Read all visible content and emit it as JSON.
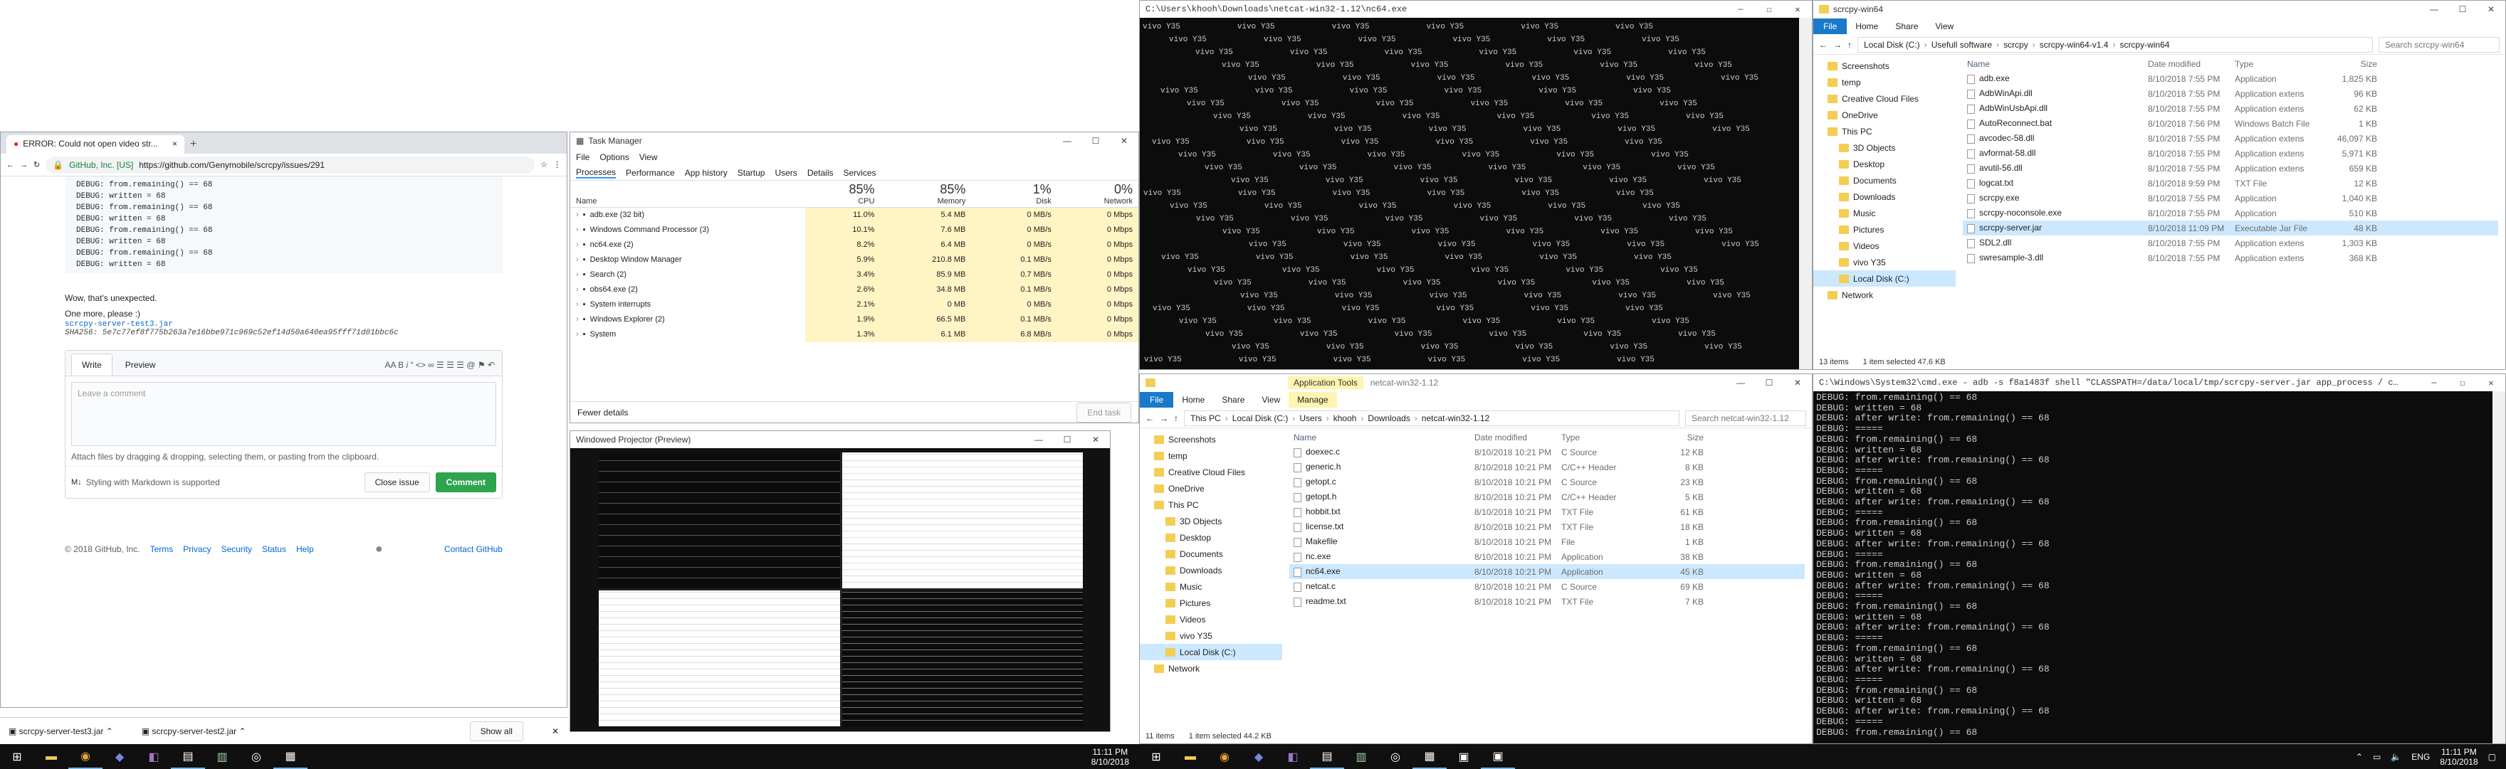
{
  "chrome": {
    "tab_title": "ERROR: Could not open video str...",
    "tab_close": "×",
    "new_tab": "+",
    "security": "GitHub, Inc. [US]",
    "url": "https://github.com/Genymobile/scrcpy/issues/291",
    "code_lines": [
      "DEBUG: from.remaining() == 68",
      "DEBUG: written = 68",
      "DEBUG: from.remaining() == 68",
      "DEBUG: written = 68",
      "DEBUG: from.remaining() == 68",
      "DEBUG: written = 68",
      "DEBUG: from.remaining() == 68",
      "DEBUG: written = 68"
    ],
    "p1": "Wow, that's unexpected.",
    "p2": "One more, please :)",
    "file_link": "scrcpy-server-test3.jar",
    "sha": "SHA256: 5e7c77ef8f775b263a7e16bbe971c969c52ef14d50a640ea95fff71d01bbc6c",
    "tab_write": "Write",
    "tab_preview": "Preview",
    "placeholder": "Leave a comment",
    "attach_text": "Attach files by dragging & dropping, selecting them, or pasting from the clipboard.",
    "markdown_note": "Styling with Markdown is supported",
    "close_issue": "Close issue",
    "comment": "Comment",
    "footer_copy": "© 2018 GitHub, Inc.",
    "footer_links": [
      "Terms",
      "Privacy",
      "Security",
      "Status",
      "Help"
    ],
    "contact": "Contact GitHub",
    "downloads": [
      "scrcpy-server-test3.jar",
      "scrcpy-server-test2.jar"
    ],
    "show_all": "Show all"
  },
  "taskmgr": {
    "title": "Task Manager",
    "menu": [
      "File",
      "Options",
      "View"
    ],
    "tabs": [
      "Processes",
      "Performance",
      "App history",
      "Startup",
      "Users",
      "Details",
      "Services"
    ],
    "headers": {
      "name": "Name",
      "cpu_pct": "85%",
      "cpu": "CPU",
      "mem_pct": "85%",
      "mem": "Memory",
      "disk_pct": "1%",
      "disk": "Disk",
      "net_pct": "0%",
      "net": "Network"
    },
    "rows": [
      {
        "name": "adb.exe (32 bit)",
        "cpu": "11.0%",
        "mem": "5.4 MB",
        "disk": "0 MB/s",
        "net": "0 Mbps"
      },
      {
        "name": "Windows Command Processor (3)",
        "cpu": "10.1%",
        "mem": "7.6 MB",
        "disk": "0 MB/s",
        "net": "0 Mbps"
      },
      {
        "name": "nc64.exe (2)",
        "cpu": "8.2%",
        "mem": "6.4 MB",
        "disk": "0 MB/s",
        "net": "0 Mbps"
      },
      {
        "name": "Desktop Window Manager",
        "cpu": "5.9%",
        "mem": "210.8 MB",
        "disk": "0.1 MB/s",
        "net": "0 Mbps"
      },
      {
        "name": "Search (2)",
        "cpu": "3.4%",
        "mem": "85.9 MB",
        "disk": "0.7 MB/s",
        "net": "0 Mbps"
      },
      {
        "name": "obs64.exe (2)",
        "cpu": "2.6%",
        "mem": "34.8 MB",
        "disk": "0.1 MB/s",
        "net": "0 Mbps"
      },
      {
        "name": "System interrupts",
        "cpu": "2.1%",
        "mem": "0 MB",
        "disk": "0 MB/s",
        "net": "0 Mbps"
      },
      {
        "name": "Windows Explorer (2)",
        "cpu": "1.9%",
        "mem": "66.5 MB",
        "disk": "0.1 MB/s",
        "net": "0 Mbps"
      },
      {
        "name": "System",
        "cpu": "1.3%",
        "mem": "6.1 MB",
        "disk": "6.8 MB/s",
        "net": "0 Mbps"
      }
    ],
    "fewer": "Fewer details",
    "end_task": "End task"
  },
  "projector": {
    "title": "Windowed Projector (Preview)"
  },
  "netcat_console": {
    "title": "C:\\Users\\khooh\\Downloads\\netcat-win32-1.12\\nc64.exe",
    "pattern": "vivo Y35"
  },
  "explorer_scrcpy": {
    "title": "scrcpy-win64",
    "ribbon": [
      "File",
      "Home",
      "Share",
      "View"
    ],
    "path": [
      "Local Disk (C:)",
      "Usefull software",
      "scrcpy",
      "scrcpy-win64-v1.4",
      "scrcpy-win64"
    ],
    "search": "Search scrcpy-win64",
    "nav": [
      "Screenshots",
      "temp",
      "Creative Cloud Files",
      "OneDrive",
      "This PC",
      "3D Objects",
      "Desktop",
      "Documents",
      "Downloads",
      "Music",
      "Pictures",
      "Videos",
      "vivo Y35",
      "Local Disk (C:)",
      "Network"
    ],
    "headers": [
      "Name",
      "Date modified",
      "Type",
      "Size"
    ],
    "files": [
      {
        "name": "adb.exe",
        "date": "8/10/2018 7:55 PM",
        "type": "Application",
        "size": "1,825 KB"
      },
      {
        "name": "AdbWinApi.dll",
        "date": "8/10/2018 7:55 PM",
        "type": "Application extens",
        "size": "96 KB"
      },
      {
        "name": "AdbWinUsbApi.dll",
        "date": "8/10/2018 7:55 PM",
        "type": "Application extens",
        "size": "62 KB"
      },
      {
        "name": "AutoReconnect.bat",
        "date": "8/10/2018 7:56 PM",
        "type": "Windows Batch File",
        "size": "1 KB"
      },
      {
        "name": "avcodec-58.dll",
        "date": "8/10/2018 7:55 PM",
        "type": "Application extens",
        "size": "46,097 KB"
      },
      {
        "name": "avformat-58.dll",
        "date": "8/10/2018 7:55 PM",
        "type": "Application extens",
        "size": "5,971 KB"
      },
      {
        "name": "avutil-56.dll",
        "date": "8/10/2018 7:55 PM",
        "type": "Application extens",
        "size": "659 KB"
      },
      {
        "name": "logcat.txt",
        "date": "8/10/2018 9:59 PM",
        "type": "TXT File",
        "size": "12 KB"
      },
      {
        "name": "scrcpy.exe",
        "date": "8/10/2018 7:55 PM",
        "type": "Application",
        "size": "1,040 KB"
      },
      {
        "name": "scrcpy-noconsole.exe",
        "date": "8/10/2018 7:55 PM",
        "type": "Application",
        "size": "510 KB"
      },
      {
        "name": "scrcpy-server.jar",
        "date": "8/10/2018 11:09 PM",
        "type": "Executable Jar File",
        "size": "48 KB"
      },
      {
        "name": "SDL2.dll",
        "date": "8/10/2018 7:55 PM",
        "type": "Application extens",
        "size": "1,303 KB"
      },
      {
        "name": "swresample-3.dll",
        "date": "8/10/2018 7:55 PM",
        "type": "Application extens",
        "size": "368 KB"
      }
    ],
    "status_items": "13 items",
    "status_sel": "1 item selected  47.6 KB"
  },
  "explorer_netcat": {
    "title": "netcat-win32-1.12",
    "ribbon": [
      "File",
      "Home",
      "Share",
      "View"
    ],
    "manage": "Manage",
    "app_tools": "Application Tools",
    "path": [
      "This PC",
      "Local Disk (C:)",
      "Users",
      "khooh",
      "Downloads",
      "netcat-win32-1.12"
    ],
    "search": "Search netcat-win32-1.12",
    "nav": [
      "Screenshots",
      "temp",
      "Creative Cloud Files",
      "OneDrive",
      "This PC",
      "3D Objects",
      "Desktop",
      "Documents",
      "Downloads",
      "Music",
      "Pictures",
      "Videos",
      "vivo Y35",
      "Local Disk (C:)",
      "Network"
    ],
    "headers": [
      "Name",
      "Date modified",
      "Type",
      "Size"
    ],
    "files": [
      {
        "name": "doexec.c",
        "date": "8/10/2018 10:21 PM",
        "type": "C Source",
        "size": "12 KB"
      },
      {
        "name": "generic.h",
        "date": "8/10/2018 10:21 PM",
        "type": "C/C++ Header",
        "size": "8 KB"
      },
      {
        "name": "getopt.c",
        "date": "8/10/2018 10:21 PM",
        "type": "C Source",
        "size": "23 KB"
      },
      {
        "name": "getopt.h",
        "date": "8/10/2018 10:21 PM",
        "type": "C/C++ Header",
        "size": "5 KB"
      },
      {
        "name": "hobbit.txt",
        "date": "8/10/2018 10:21 PM",
        "type": "TXT File",
        "size": "61 KB"
      },
      {
        "name": "license.txt",
        "date": "8/10/2018 10:21 PM",
        "type": "TXT File",
        "size": "18 KB"
      },
      {
        "name": "Makefile",
        "date": "8/10/2018 10:21 PM",
        "type": "File",
        "size": "1 KB"
      },
      {
        "name": "nc.exe",
        "date": "8/10/2018 10:21 PM",
        "type": "Application",
        "size": "38 KB"
      },
      {
        "name": "nc64.exe",
        "date": "8/10/2018 10:21 PM",
        "type": "Application",
        "size": "45 KB"
      },
      {
        "name": "netcat.c",
        "date": "8/10/2018 10:21 PM",
        "type": "C Source",
        "size": "69 KB"
      },
      {
        "name": "readme.txt",
        "date": "8/10/2018 10:21 PM",
        "type": "TXT File",
        "size": "7 KB"
      }
    ],
    "status_items": "11 items",
    "status_sel": "1 item selected  44.2 KB"
  },
  "cmd_console": {
    "title": "C:\\Windows\\System32\\cmd.exe - adb -s f8a1483f shell \"CLASSPATH=/data/local/tmp/scrcpy-server.jar app_process / com.genymobile.scrcpy.Serv...",
    "lines": [
      "DEBUG: from.remaining() == 68",
      "DEBUG: written = 68",
      "DEBUG: after write: from.remaining() == 68",
      "DEBUG: =====",
      "DEBUG: from.remaining() == 68",
      "DEBUG: written = 68",
      "DEBUG: after write: from.remaining() == 68",
      "DEBUG: =====",
      "DEBUG: from.remaining() == 68",
      "DEBUG: written = 68",
      "DEBUG: after write: from.remaining() == 68",
      "DEBUG: =====",
      "DEBUG: from.remaining() == 68",
      "DEBUG: written = 68",
      "DEBUG: after write: from.remaining() == 68",
      "DEBUG: =====",
      "DEBUG: from.remaining() == 68",
      "DEBUG: written = 68",
      "DEBUG: after write: from.remaining() == 68",
      "DEBUG: =====",
      "DEBUG: from.remaining() == 68",
      "DEBUG: written = 68",
      "DEBUG: after write: from.remaining() == 68",
      "DEBUG: =====",
      "DEBUG: from.remaining() == 68",
      "DEBUG: written = 68",
      "DEBUG: after write: from.remaining() == 68",
      "DEBUG: =====",
      "DEBUG: from.remaining() == 68",
      "DEBUG: written = 68",
      "DEBUG: after write: from.remaining() == 68",
      "DEBUG: =====",
      "DEBUG: from.remaining() == 68"
    ]
  },
  "taskbar_left": {
    "time": "11:11 PM",
    "date": "8/10/2018"
  },
  "taskbar_right": {
    "time": "11:11 PM",
    "date": "8/10/2018",
    "lang": "ENG"
  }
}
